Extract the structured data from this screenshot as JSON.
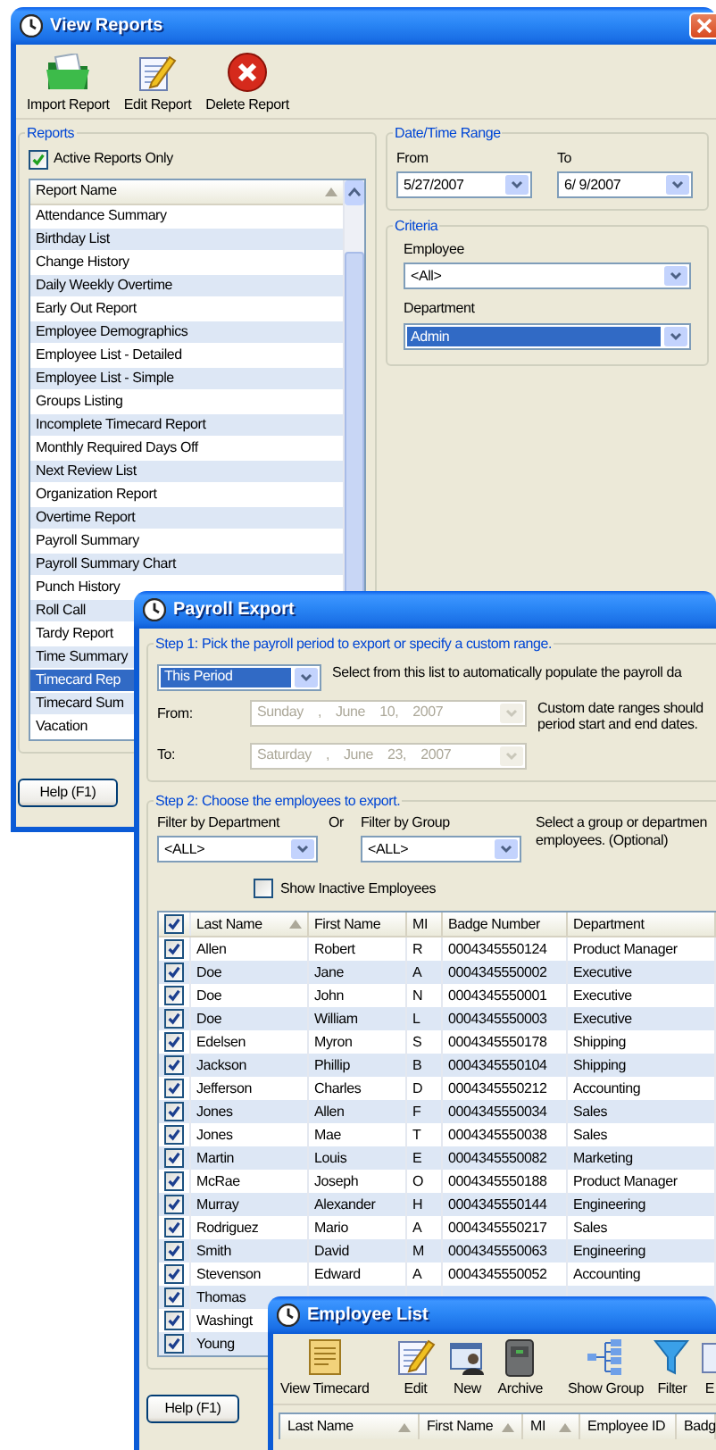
{
  "view_reports": {
    "title": "View Reports",
    "toolbar": [
      {
        "kind": "import",
        "label": "Import Report"
      },
      {
        "kind": "edit",
        "label": "Edit Report"
      },
      {
        "kind": "delete",
        "label": "Delete Report"
      }
    ],
    "reports": {
      "label": "Reports",
      "active_only": {
        "label": "Active Reports Only",
        "checked": true
      },
      "list": {
        "column": "Report Name",
        "items": [
          {
            "label": "Attendance Summary",
            "selected": false
          },
          {
            "label": "Birthday List",
            "selected": false
          },
          {
            "label": "Change History",
            "selected": false
          },
          {
            "label": "Daily Weekly Overtime",
            "selected": false
          },
          {
            "label": "Early Out Report",
            "selected": false
          },
          {
            "label": "Employee Demographics",
            "selected": false
          },
          {
            "label": "Employee List - Detailed",
            "selected": false
          },
          {
            "label": "Employee List - Simple",
            "selected": false
          },
          {
            "label": "Groups Listing",
            "selected": false
          },
          {
            "label": "Incomplete Timecard Report",
            "selected": false
          },
          {
            "label": "Monthly Required Days Off",
            "selected": false
          },
          {
            "label": "Next Review List",
            "selected": false
          },
          {
            "label": "Organization Report",
            "selected": false
          },
          {
            "label": "Overtime Report",
            "selected": false
          },
          {
            "label": "Payroll Summary",
            "selected": false
          },
          {
            "label": "Payroll Summary Chart",
            "selected": false
          },
          {
            "label": "Punch History",
            "selected": false
          },
          {
            "label": "Roll Call",
            "selected": false
          },
          {
            "label": "Tardy Report",
            "selected": false
          },
          {
            "label": "Time Summary",
            "selected": false
          },
          {
            "label": "Timecard Rep",
            "selected": true
          },
          {
            "label": "Timecard Sum",
            "selected": false
          },
          {
            "label": "Vacation",
            "selected": false
          }
        ]
      }
    },
    "date_range": {
      "label": "Date/Time Range",
      "from": {
        "label": "From",
        "value": "5/27/2007"
      },
      "to": {
        "label": "To",
        "value": "6/ 9/2007"
      }
    },
    "criteria": {
      "label": "Criteria",
      "employee": {
        "label": "Employee",
        "value": "<All>",
        "focused": false
      },
      "department": {
        "label": "Department",
        "value": "Admin",
        "focused": true
      }
    },
    "help_button": "Help (F1)"
  },
  "payroll_export": {
    "title": "Payroll Export",
    "step1": {
      "label": "Step 1: Pick the payroll period to export or specify a custom range.",
      "period": {
        "value": "This Period",
        "focused": true
      },
      "period_hint": "Select from this list to automatically populate the payroll da",
      "from": {
        "label": "From:",
        "value": "Sunday , June 10, 2007",
        "disabled": true
      },
      "to": {
        "label": "To:",
        "value": "Saturday , June 23, 2007",
        "disabled": true
      },
      "custom_hint_lines": [
        "Custom date ranges should",
        "period start and end dates."
      ]
    },
    "step2": {
      "label": "Step 2: Choose the employees to export.",
      "department_filter": {
        "label": "Filter by Department",
        "value": "<ALL>"
      },
      "or_label": "Or",
      "group_filter": {
        "label": "Filter by Group",
        "value": "<ALL>"
      },
      "hint_lines": [
        "Select a group or departmen",
        "employees. (Optional)"
      ],
      "show_inactive": {
        "label": "Show Inactive Employees",
        "checked": false
      },
      "table": {
        "all_checked": true,
        "columns": [
          {
            "label": "Last Name",
            "sorted": true
          },
          {
            "label": "First Name",
            "sorted": false
          },
          {
            "label": "MI",
            "sorted": false
          },
          {
            "label": "Badge Number",
            "sorted": false
          },
          {
            "label": "Department",
            "sorted": false
          }
        ],
        "rows": [
          {
            "checked": true,
            "cells": [
              "Allen",
              "Robert",
              "R",
              "0004345550124",
              "Product Manager"
            ]
          },
          {
            "checked": true,
            "cells": [
              "Doe",
              "Jane",
              "A",
              "0004345550002",
              "Executive"
            ]
          },
          {
            "checked": true,
            "cells": [
              "Doe",
              "John",
              "N",
              "0004345550001",
              "Executive"
            ]
          },
          {
            "checked": true,
            "cells": [
              "Doe",
              "William",
              "L",
              "0004345550003",
              "Executive"
            ]
          },
          {
            "checked": true,
            "cells": [
              "Edelsen",
              "Myron",
              "S",
              "0004345550178",
              "Shipping"
            ]
          },
          {
            "checked": true,
            "cells": [
              "Jackson",
              "Phillip",
              "B",
              "0004345550104",
              "Shipping"
            ]
          },
          {
            "checked": true,
            "cells": [
              "Jefferson",
              "Charles",
              "D",
              "0004345550212",
              "Accounting"
            ]
          },
          {
            "checked": true,
            "cells": [
              "Jones",
              "Allen",
              "F",
              "0004345550034",
              "Sales"
            ]
          },
          {
            "checked": true,
            "cells": [
              "Jones",
              "Mae",
              "T",
              "0004345550038",
              "Sales"
            ]
          },
          {
            "checked": true,
            "cells": [
              "Martin",
              "Louis",
              "E",
              "0004345550082",
              "Marketing"
            ]
          },
          {
            "checked": true,
            "cells": [
              "McRae",
              "Joseph",
              "O",
              "0004345550188",
              "Product Manager"
            ]
          },
          {
            "checked": true,
            "cells": [
              "Murray",
              "Alexander",
              "H",
              "0004345550144",
              "Engineering"
            ]
          },
          {
            "checked": true,
            "cells": [
              "Rodriguez",
              "Mario",
              "A",
              "0004345550217",
              "Sales"
            ]
          },
          {
            "checked": true,
            "cells": [
              "Smith",
              "David",
              "M",
              "0004345550063",
              "Engineering"
            ]
          },
          {
            "checked": true,
            "cells": [
              "Stevenson",
              "Edward",
              "A",
              "0004345550052",
              "Accounting"
            ]
          },
          {
            "checked": true,
            "cells": [
              "Thomas"
            ]
          },
          {
            "checked": true,
            "cells": [
              "Washingt"
            ]
          },
          {
            "checked": true,
            "cells": [
              "Young"
            ]
          }
        ]
      }
    },
    "help_button": "Help (F1)"
  },
  "employee_list": {
    "title": "Employee List",
    "toolbar": [
      {
        "kind": "timecard",
        "label": "View Timecard",
        "separator_before": false
      },
      {
        "kind": "edit",
        "label": "Edit",
        "separator_before": true
      },
      {
        "kind": "new",
        "label": "New",
        "separator_before": false
      },
      {
        "kind": "archive",
        "label": "Archive",
        "separator_before": false
      },
      {
        "kind": "group",
        "label": "Show Group",
        "separator_before": true
      },
      {
        "kind": "filter",
        "label": "Filter",
        "separator_before": false
      },
      {
        "kind": "export",
        "label": "E",
        "separator_before": false
      }
    ],
    "columns": [
      {
        "label": "Last Name",
        "sorted": true
      },
      {
        "label": "First Name",
        "sorted": true
      },
      {
        "label": "MI",
        "sorted": true
      },
      {
        "label": "Employee ID",
        "sorted": false
      },
      {
        "label": "Badg",
        "sorted": false
      }
    ]
  }
}
